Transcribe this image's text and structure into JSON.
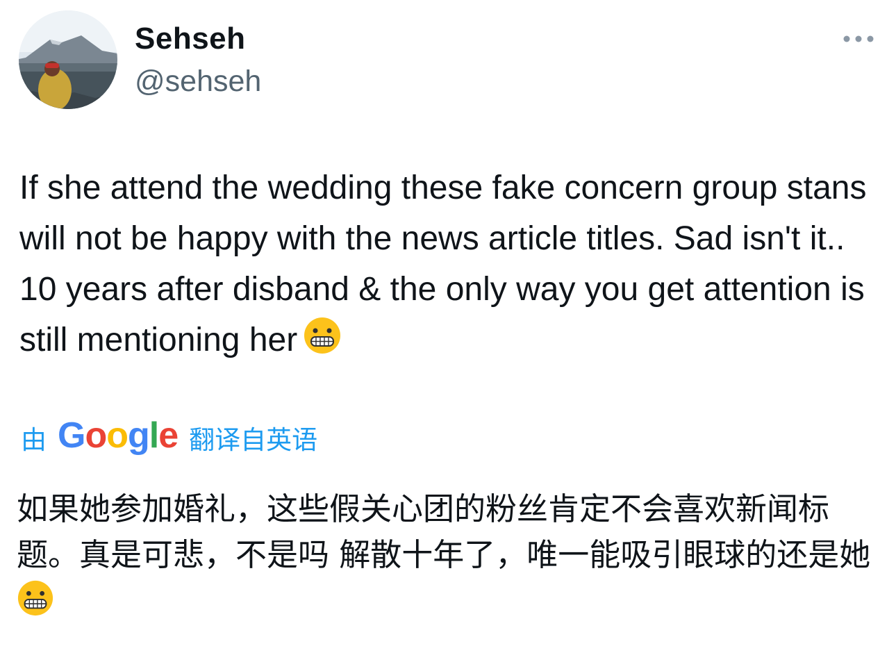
{
  "tweet": {
    "author": {
      "display_name": "Sehseh",
      "handle": "@sehseh"
    },
    "menu_icon": "more-horizontal-icon",
    "text": "If she attend the wedding these fake concern group stans will not be happy with the news article titles. Sad isn't it.. 10 years after disband & the only way you get attention is still mentioning her",
    "emoji": "grimacing-face-emoji",
    "translation": {
      "prefix": "由",
      "provider": "Google",
      "suffix": "翻译自英语",
      "text": "如果她参加婚礼，这些假关心团的粉丝肯定不会喜欢新闻标题。真是可悲，不是吗 解散十年了，唯一能吸引眼球的还是她"
    }
  },
  "colors": {
    "text_primary": "#0f1419",
    "text_secondary": "#536471",
    "link_blue": "#1d9bf0"
  }
}
